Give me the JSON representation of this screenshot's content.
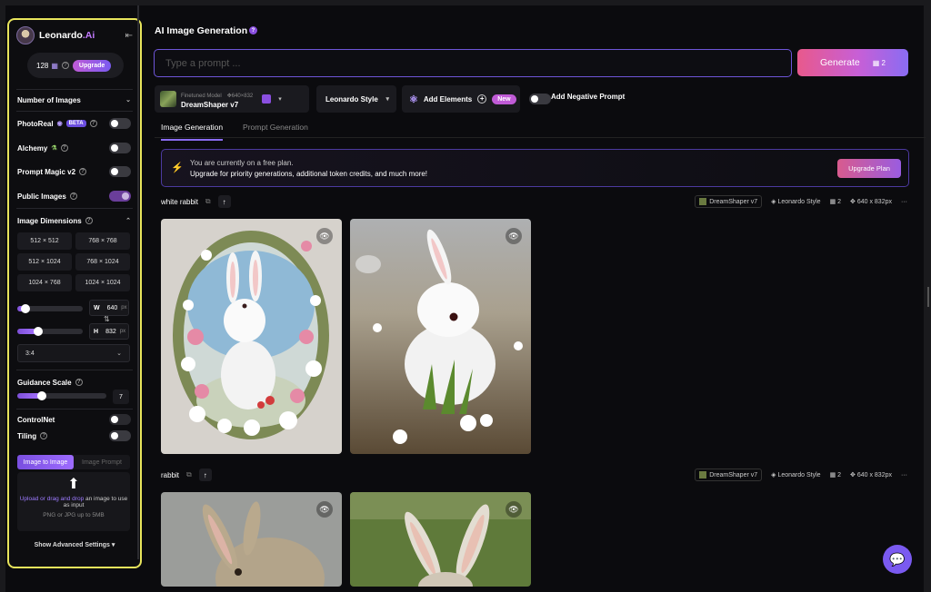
{
  "brand": {
    "name": "Leonardo",
    "suffix": ".Ai"
  },
  "tokens": {
    "count": "128",
    "upgrade_label": "Upgrade"
  },
  "sidebar": {
    "num_images_label": "Number of Images",
    "photoreal_label": "PhotoReal",
    "beta_label": "BETA",
    "alchemy_label": "Alchemy",
    "prompt_magic_label": "Prompt Magic v2",
    "public_images_label": "Public Images",
    "image_dimensions_label": "Image Dimensions",
    "dimensions": [
      "512 × 512",
      "768 × 768",
      "512 × 1024",
      "768 × 1024",
      "1024 × 768",
      "1024 × 1024"
    ],
    "width_label": "W",
    "width_value": "640",
    "height_label": "H",
    "height_value": "832",
    "unit": "px",
    "aspect_ratio": "3:4",
    "guidance_label": "Guidance Scale",
    "guidance_value": "7",
    "guidance_level": 0.28,
    "controlnet_label": "ControlNet",
    "tiling_label": "Tiling",
    "tab_image_to_image": "Image to Image",
    "tab_image_prompt": "Image Prompt",
    "upload_link": "Upload or drag and drop",
    "upload_text": "an image to use as input",
    "upload_sub": "PNG or JPG up to 5MB",
    "advanced_label": "Show Advanced Settings"
  },
  "main": {
    "title": "AI Image Generation",
    "prompt_placeholder": "Type a prompt ...",
    "generate_label": "Generate",
    "generate_count": "2",
    "model_sub": "Finetuned Model",
    "model_size": "640×832",
    "model_name": "DreamShaper v7",
    "style_label": "Leonardo Style",
    "elements_label": "Add Elements",
    "new_label": "New",
    "negative_label": "Add Negative Prompt",
    "tabs": [
      "Image Generation",
      "Prompt Generation"
    ],
    "banner_line1": "You are currently on a free plan.",
    "banner_line2": "Upgrade for priority generations, additional token credits, and much more!",
    "upgrade_plan_label": "Upgrade Plan",
    "generations": [
      {
        "prompt": "white rabbit",
        "model": "DreamShaper v7",
        "style": "Leonardo Style",
        "count": "2",
        "size": "640 x 832px"
      },
      {
        "prompt": "rabbit",
        "model": "DreamShaper v7",
        "style": "Leonardo Style",
        "count": "2",
        "size": "640 x 832px"
      }
    ]
  },
  "colors": {
    "accent": "#8a6cf2",
    "highlight_border": "#e8e55c",
    "generate_start": "#e8598c"
  }
}
